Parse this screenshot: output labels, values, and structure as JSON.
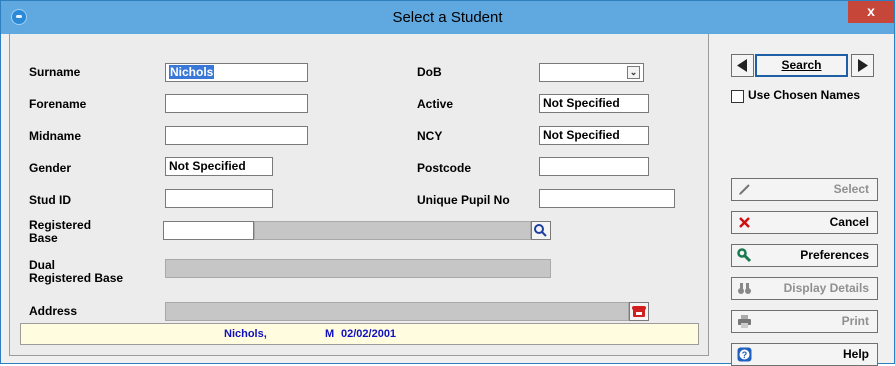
{
  "window": {
    "title": "Select a Student",
    "close_label": "x"
  },
  "form": {
    "surname": {
      "label": "Surname",
      "value": "Nichols"
    },
    "forename": {
      "label": "Forename",
      "value": ""
    },
    "midname": {
      "label": "Midname",
      "value": ""
    },
    "gender": {
      "label": "Gender",
      "value": "Not Specified"
    },
    "stud_id": {
      "label": "Stud ID",
      "value": ""
    },
    "registered_base": {
      "label_line1": "Registered",
      "label_line2": "Base",
      "code": "",
      "name": ""
    },
    "dual_registered_base": {
      "label_line1": "Dual",
      "label_line2": "Registered Base",
      "value": ""
    },
    "address": {
      "label": "Address",
      "value": ""
    },
    "dob": {
      "label": "DoB",
      "value": ""
    },
    "active": {
      "label": "Active",
      "value": "Not Specified"
    },
    "ncy": {
      "label": "NCY",
      "value": "Not Specified"
    },
    "postcode": {
      "label": "Postcode",
      "value": ""
    },
    "upn": {
      "label": "Unique Pupil No",
      "value": ""
    }
  },
  "status": {
    "name": "Nichols,",
    "gender": "M",
    "dob": "02/02/2001"
  },
  "sidebar": {
    "search_label": "Search",
    "use_chosen_names_label": "Use Chosen Names",
    "use_chosen_names_checked": false,
    "buttons": [
      {
        "label": "Select",
        "enabled": false,
        "icon": "pencil-icon"
      },
      {
        "label": "Cancel",
        "enabled": true,
        "icon": "x-icon"
      },
      {
        "label": "Preferences",
        "enabled": true,
        "icon": "wrench-icon"
      },
      {
        "label": "Display Details",
        "enabled": false,
        "icon": "binoculars-icon"
      },
      {
        "label": "Print",
        "enabled": false,
        "icon": "printer-icon"
      },
      {
        "label": "Help",
        "enabled": true,
        "icon": "question-icon"
      }
    ]
  },
  "colors": {
    "titlebar": "#5fa9e0",
    "close": "#c7463a",
    "status_text": "#1010c0",
    "status_bg": "#fffce0",
    "selection": "#3a78d8"
  }
}
